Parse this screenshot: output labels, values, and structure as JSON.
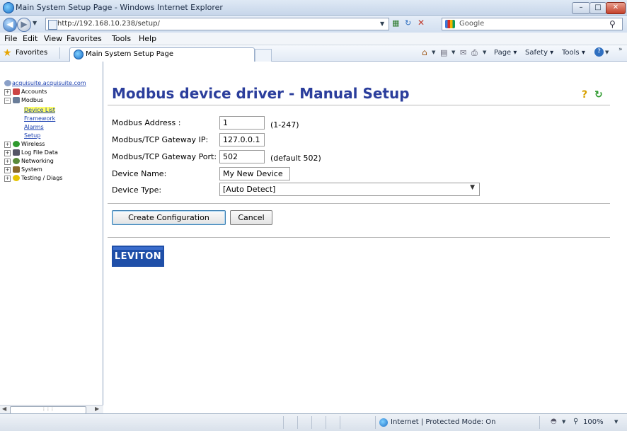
{
  "window": {
    "title": "Main System Setup Page - Windows Internet Explorer",
    "controls": {
      "minimize": "–",
      "maximize": "□",
      "close": "✕"
    }
  },
  "browser": {
    "address": "http://192.168.10.238/setup/",
    "search_placeholder": "Google",
    "menu": [
      "File",
      "Edit",
      "View",
      "Favorites",
      "Tools",
      "Help"
    ],
    "favorites_label": "Favorites",
    "tab_title": "Main System Setup Page",
    "commands": [
      "Page ▾",
      "Safety ▾",
      "Tools ▾"
    ],
    "status": {
      "zone": "Internet | Protected Mode: On",
      "zoom": "100%"
    }
  },
  "tree": {
    "root": "acquisuite.acquisuite.com",
    "items": [
      {
        "label": "Accounts"
      },
      {
        "label": "Modbus"
      },
      {
        "label": "Device List"
      },
      {
        "label": "Framework"
      },
      {
        "label": "Alarms"
      },
      {
        "label": "Setup"
      },
      {
        "label": "Wireless"
      },
      {
        "label": "Log File Data"
      },
      {
        "label": "Networking"
      },
      {
        "label": "System"
      },
      {
        "label": "Testing / Diags"
      }
    ]
  },
  "page": {
    "heading": "Modbus device driver - Manual Setup",
    "fields": {
      "address": {
        "label": "Modbus Address :",
        "value": "1",
        "hint": "(1-247)"
      },
      "gateway_ip": {
        "label": "Modbus/TCP Gateway IP:",
        "value": "127.0.0.1"
      },
      "gateway_port": {
        "label": "Modbus/TCP Gateway Port:",
        "value": "502",
        "hint": "(default 502)"
      },
      "device_name": {
        "label": "Device Name:",
        "value": "My New Device"
      },
      "device_type": {
        "label": "Device Type:",
        "value": "[Auto Detect]"
      }
    },
    "buttons": {
      "create": "Create Configuration",
      "cancel": "Cancel"
    },
    "logo": "LEVITON"
  },
  "colors": {
    "heading": "#2b3e9c",
    "selected_tree_bg": "#ffff66",
    "link": "#1a3fb0"
  },
  "icons": [
    "ie-logo-icon",
    "back-icon",
    "forward-icon",
    "refresh-icon",
    "stop-icon",
    "search-icon",
    "favorites-star-icon",
    "home-icon",
    "feeds-icon",
    "mail-icon",
    "print-icon",
    "help-icon",
    "globe-icon",
    "zoom-icon"
  ]
}
